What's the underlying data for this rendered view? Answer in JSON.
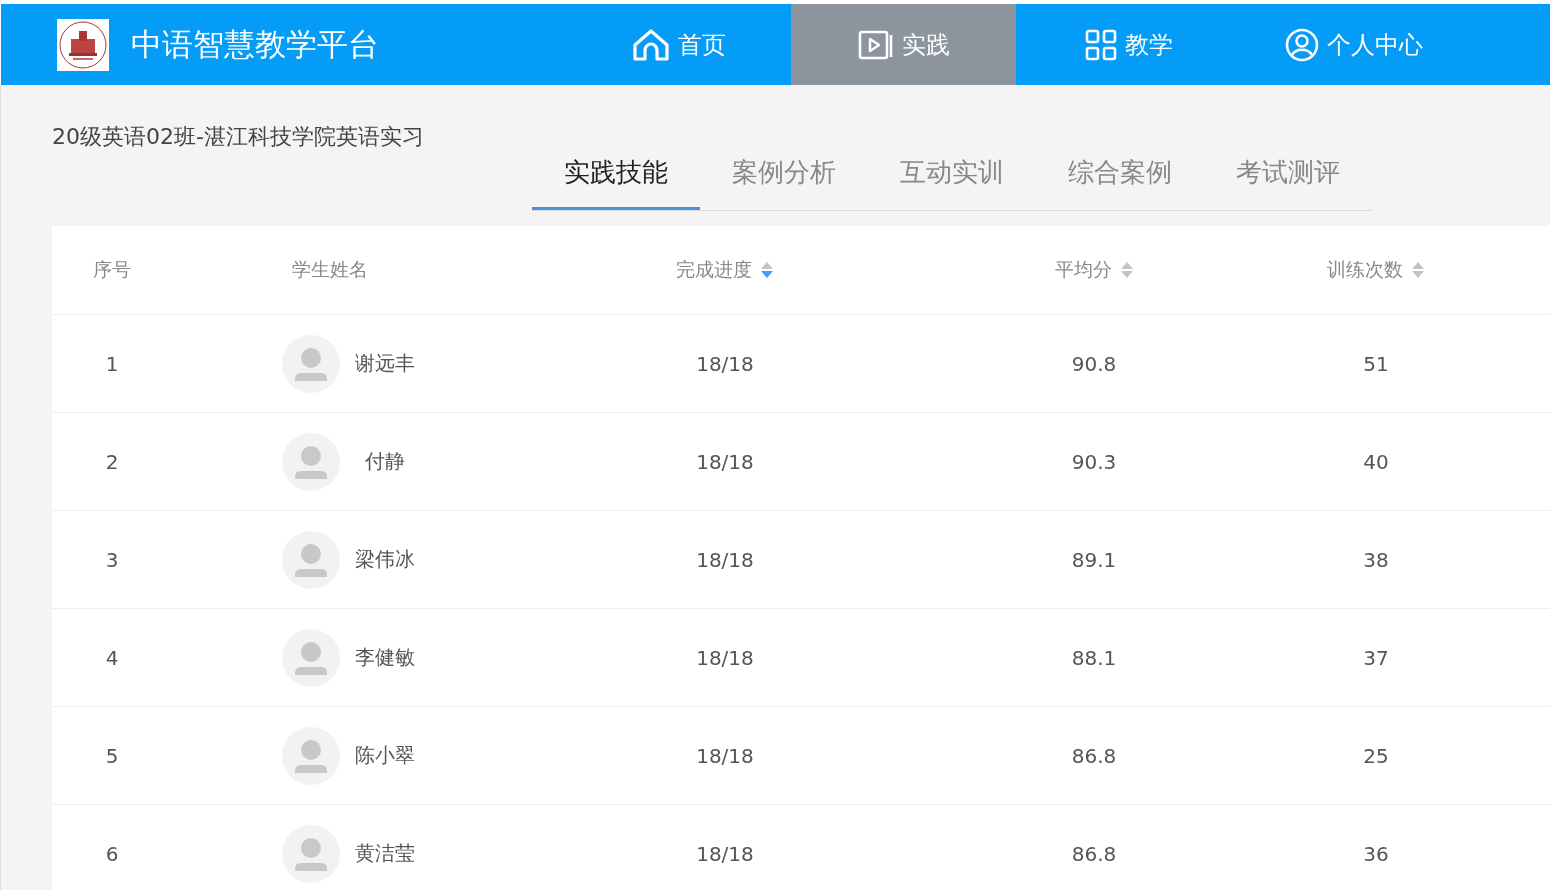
{
  "header": {
    "title": "中语智慧教学平台",
    "nav": [
      {
        "label": "首页",
        "kind": "home",
        "selected": false
      },
      {
        "label": "实践",
        "kind": "play",
        "selected": true
      },
      {
        "label": "教学",
        "kind": "grid",
        "selected": false
      },
      {
        "label": "个人中心",
        "kind": "user",
        "selected": false
      }
    ]
  },
  "course_title": "20级英语02班-湛江科技学院英语实习",
  "tabs": [
    {
      "label": "实践技能",
      "selected": true
    },
    {
      "label": "案例分析",
      "selected": false
    },
    {
      "label": "互动实训",
      "selected": false
    },
    {
      "label": "综合案例",
      "selected": false
    },
    {
      "label": "考试测评",
      "selected": false
    }
  ],
  "table": {
    "columns": [
      {
        "label": "序号",
        "sortable": false
      },
      {
        "label": "学生姓名",
        "sortable": false
      },
      {
        "label": "完成进度",
        "sortable": true,
        "sorted_descending": true
      },
      {
        "label": "平均分",
        "sortable": true,
        "sorted_descending": false
      },
      {
        "label": "训练次数",
        "sortable": true,
        "sorted_descending": false
      }
    ],
    "rows": [
      {
        "index": "1",
        "name": "谢远丰",
        "progress": "18/18",
        "average": "90.8",
        "count": "51"
      },
      {
        "index": "2",
        "name": "付静",
        "progress": "18/18",
        "average": "90.3",
        "count": "40"
      },
      {
        "index": "3",
        "name": "梁伟冰",
        "progress": "18/18",
        "average": "89.1",
        "count": "38"
      },
      {
        "index": "4",
        "name": "李健敏",
        "progress": "18/18",
        "average": "88.1",
        "count": "37"
      },
      {
        "index": "5",
        "name": "陈小翠",
        "progress": "18/18",
        "average": "86.8",
        "count": "25"
      },
      {
        "index": "6",
        "name": "黄洁莹",
        "progress": "18/18",
        "average": "86.8",
        "count": "36"
      }
    ]
  }
}
